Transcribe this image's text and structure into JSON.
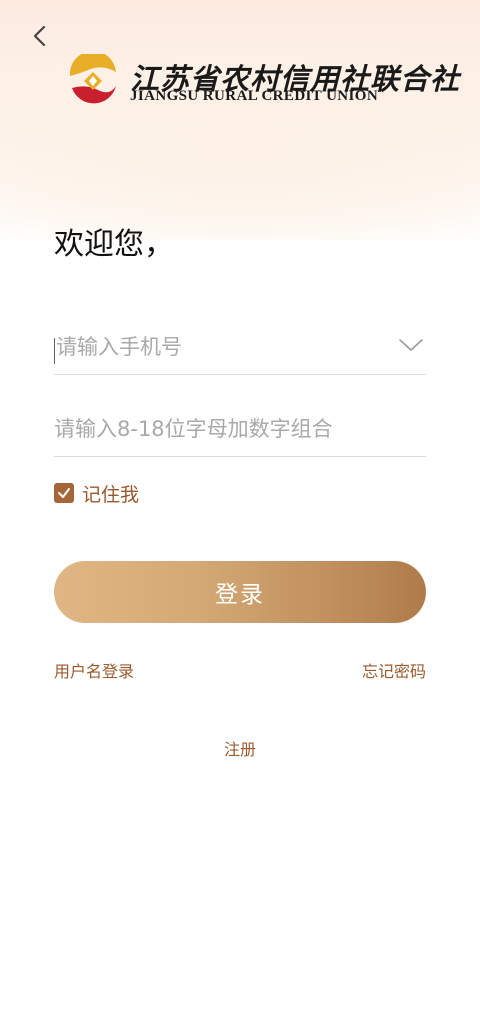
{
  "header": {
    "back_icon": "chevron-left-icon",
    "logo": {
      "name_cn": "江苏省农村信用社联合社",
      "name_en": "JIANGSU RURAL CREDIT UNION",
      "colors": {
        "gold": "#e9ae27",
        "red": "#c8202e"
      }
    }
  },
  "welcome": "欢迎您，",
  "form": {
    "phone": {
      "value": "",
      "placeholder": "请输入手机号",
      "dropdown_icon": "chevron-down-icon"
    },
    "password": {
      "value": "",
      "placeholder": "请输入8-18位字母加数字组合"
    },
    "remember": {
      "label": "记住我",
      "checked": true
    }
  },
  "login_button": "登录",
  "links": {
    "username_login": "用户名登录",
    "forgot_password": "忘记密码",
    "register": "注册"
  },
  "colors": {
    "accent": "#a5673a",
    "link": "#9a5a2e",
    "button_start": "#e0b784",
    "button_end": "#b07a4b"
  }
}
